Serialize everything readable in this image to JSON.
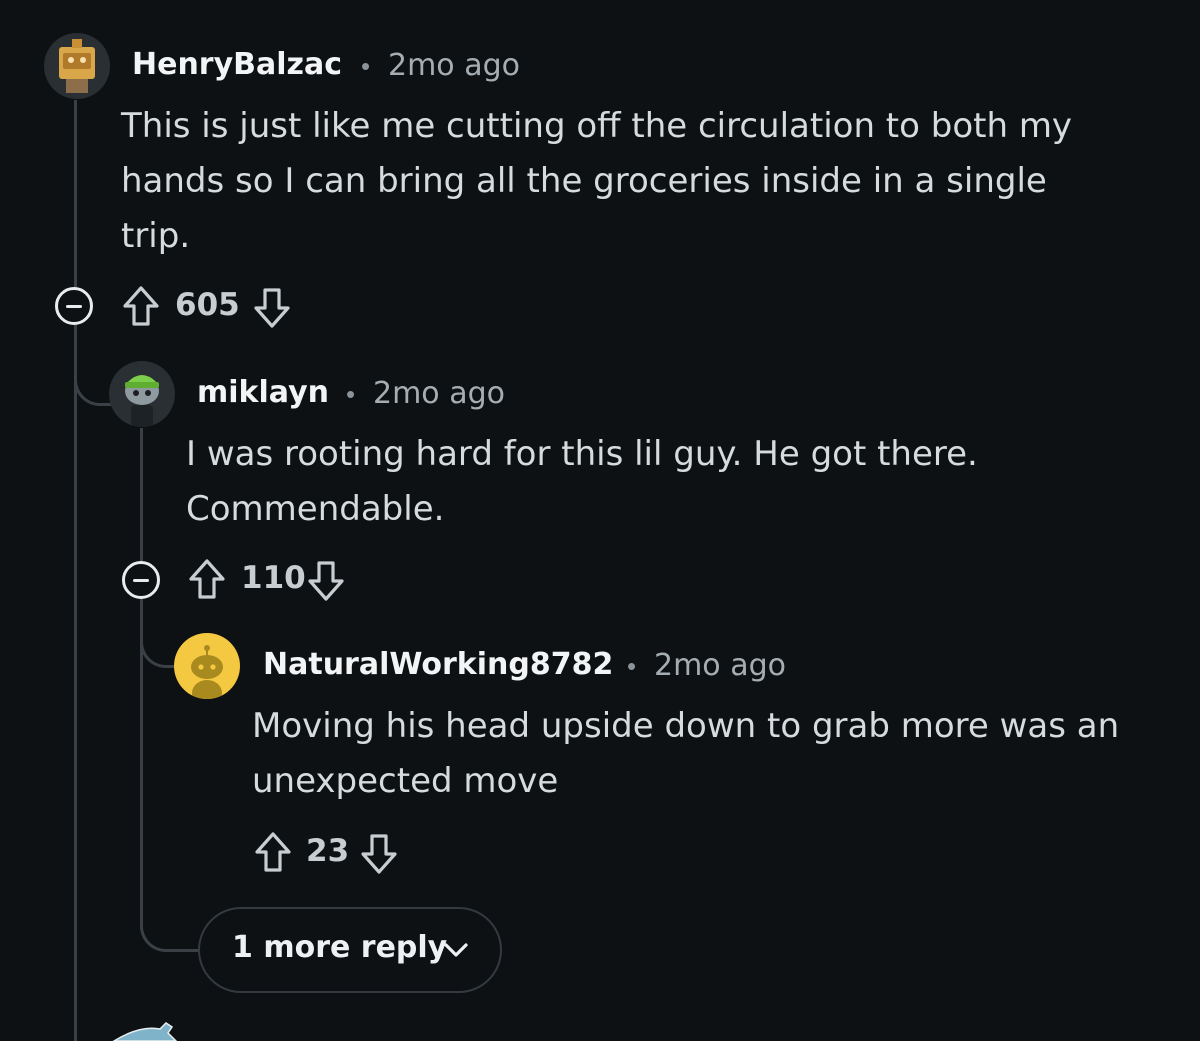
{
  "comments": [
    {
      "username": "HenryBalzac",
      "separator": "•",
      "time": "2mo ago",
      "body_lines": [
        "This is just like me cutting off the circulation to both my",
        "hands so I can bring all the groceries inside in a single",
        "trip."
      ],
      "score": "605",
      "avatar_icon": "box-robot-avatar-icon"
    },
    {
      "username": "miklayn",
      "separator": "•",
      "time": "2mo ago",
      "body_lines": [
        "I was rooting hard for this lil guy. He got there.",
        "Commendable."
      ],
      "score": "110",
      "avatar_icon": "snoo-beanie-avatar-icon"
    },
    {
      "username": "NaturalWorking8782",
      "separator": "•",
      "time": "2mo ago",
      "body_lines": [
        "Moving his head upside down to grab more was an",
        "unexpected move"
      ],
      "score": "23",
      "avatar_icon": "default-snoo-yellow-avatar-icon"
    }
  ],
  "more_replies": {
    "label": "1 more reply",
    "icon": "chevron-down-icon"
  },
  "colors": {
    "background": "#0e1113",
    "thread_line": "#3a4045",
    "avatar_yellow": "#f5c842"
  }
}
